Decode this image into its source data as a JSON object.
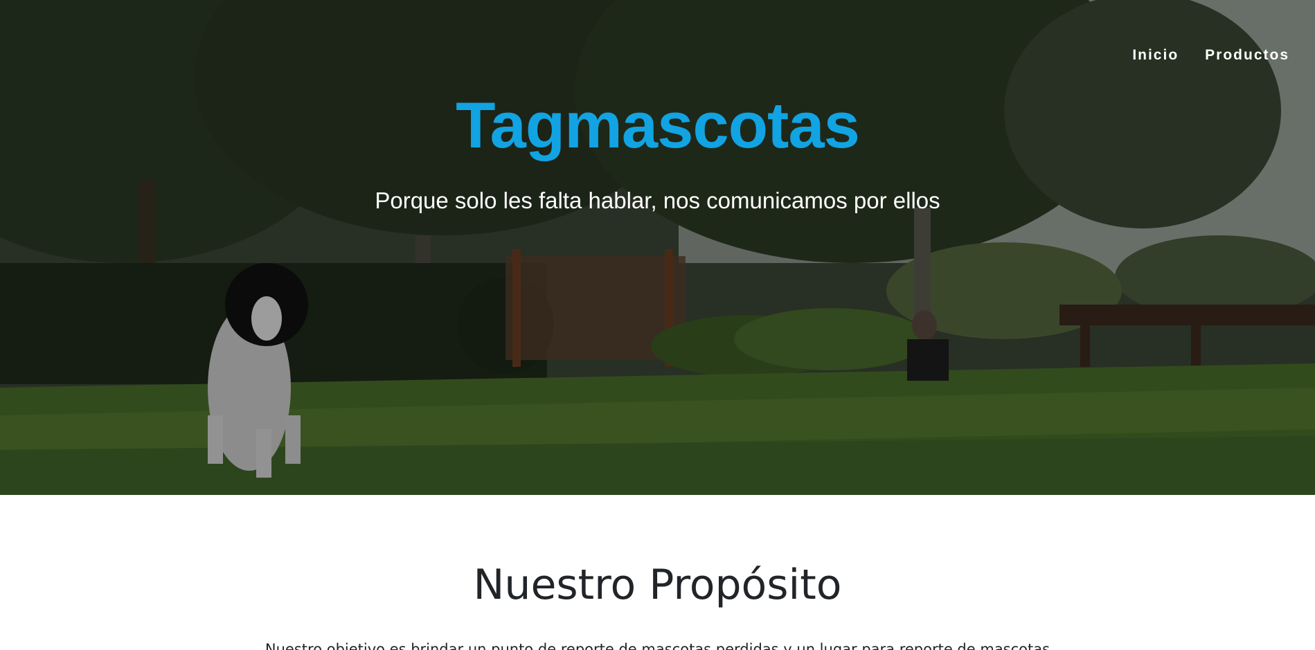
{
  "nav": {
    "items": [
      {
        "label": "Inicio"
      },
      {
        "label": "Productos"
      }
    ]
  },
  "hero": {
    "title": "Tagmascotas",
    "tagline": "Porque solo les falta hablar, nos comunicamos por ellos",
    "background_image": "park-with-dog-photo",
    "title_color": "#12a3e3"
  },
  "purpose": {
    "title": "Nuestro Propósito",
    "text": "Nuestro objetivo es brindar un punto de reporte de mascotas perdidas y un lugar para reporte de mascotas"
  }
}
